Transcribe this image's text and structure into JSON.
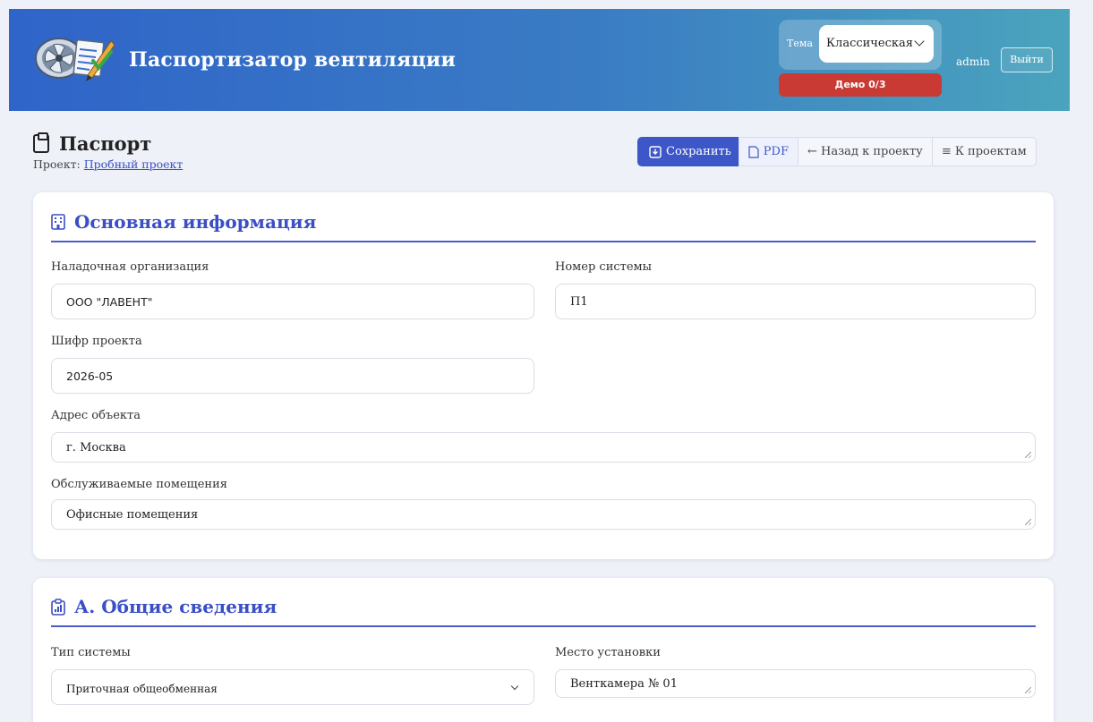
{
  "app": {
    "title": "Паспортизатор вентиляции",
    "theme_label": "Тема",
    "theme_value": "Классическая",
    "demo_badge": "Демо 0/3",
    "user": "admin",
    "logout_label": "Выйти"
  },
  "page": {
    "title": "Паспорт",
    "project_prefix": "Проект: ",
    "project_link": "Пробный проект"
  },
  "toolbar": {
    "save_label": "Сохранить",
    "pdf_label": "PDF",
    "back_label": "← Назад к проекту",
    "projects_label": "≡ К проектам"
  },
  "main_info": {
    "title": "Основная информация",
    "org_label": "Наладочная организация",
    "org_value": "ООО \"ЛАВЕНТ\"",
    "system_number_label": "Номер системы",
    "system_number_value": "П1",
    "project_code_label": "Шифр проекта",
    "project_code_value": "2026-05",
    "address_label": "Адрес объекта",
    "address_value": "г. Москва",
    "rooms_label": "Обслуживаемые помещения",
    "rooms_value": "Офисные помещения"
  },
  "general": {
    "title": "А. Общие сведения",
    "system_type_label": "Тип системы",
    "system_type_value": "Приточная общеобменная",
    "location_label": "Место установки",
    "location_value": "Венткамера № 01"
  },
  "colors": {
    "accent": "#3d56c8",
    "header_start": "#2f64c9",
    "header_end": "#4aa4bd",
    "demo_badge": "#c93a34"
  }
}
